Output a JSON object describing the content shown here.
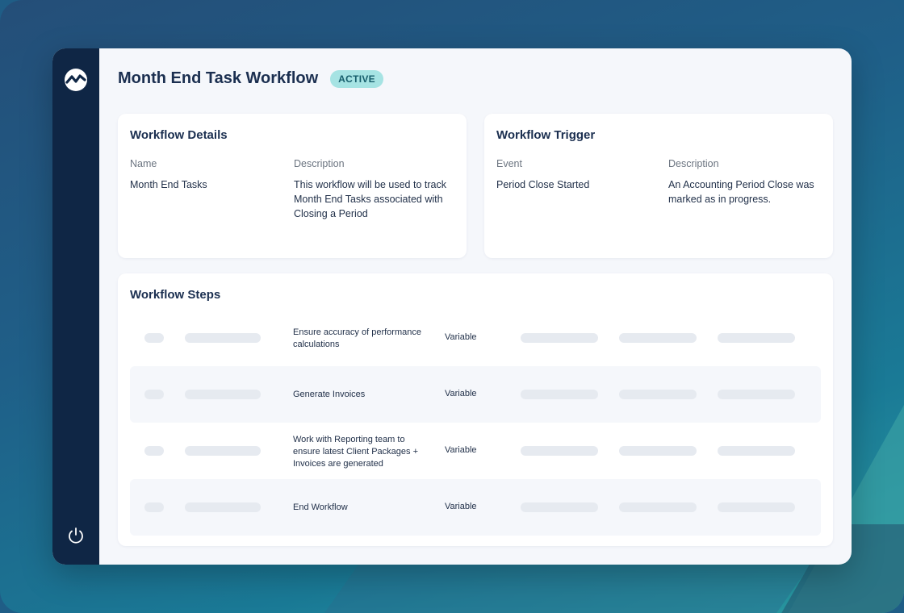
{
  "page": {
    "title": "Month End Task Workflow",
    "status_badge": "ACTIVE"
  },
  "details": {
    "title": "Workflow Details",
    "name_label": "Name",
    "name_value": "Month End Tasks",
    "description_label": "Description",
    "description_value": "This workflow will be used to track Month End Tasks associated with Closing a Period"
  },
  "trigger": {
    "title": "Workflow Trigger",
    "event_label": "Event",
    "event_value": "Period Close Started",
    "description_label": "Description",
    "description_value": "An Accounting Period Close was marked as in progress."
  },
  "steps": {
    "title": "Workflow Steps",
    "rows": [
      {
        "name": "Ensure accuracy of performance  calculations",
        "type": "Variable"
      },
      {
        "name": "Generate Invoices",
        "type": "Variable"
      },
      {
        "name": "Work with Reporting team to ensure latest Client Packages + Invoices are generated",
        "type": "Variable"
      },
      {
        "name": "End Workflow",
        "type": "Variable"
      }
    ]
  },
  "colors": {
    "sidebar": "#0f2645",
    "badge_bg": "#a6e3e3",
    "title_text": "#1b2f50"
  },
  "icons": {
    "logo": "brand-chart-logo-icon",
    "power": "power-icon"
  }
}
